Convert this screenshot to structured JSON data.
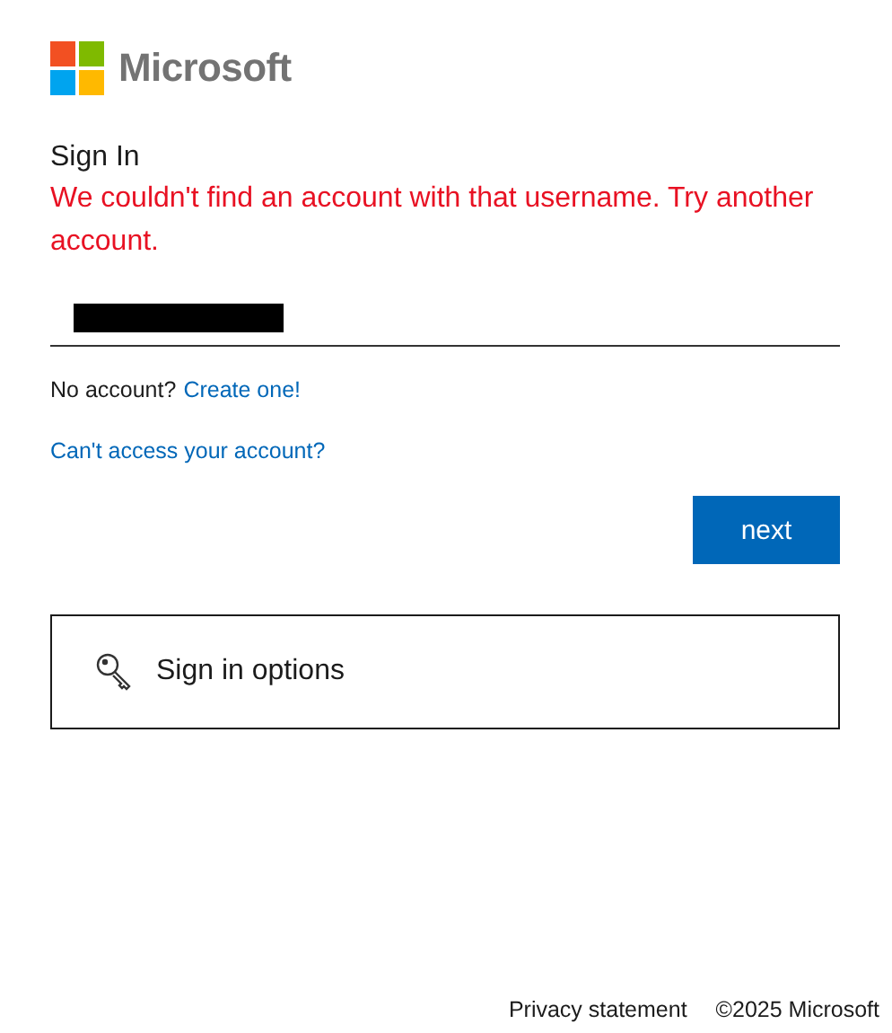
{
  "brand": {
    "name": "Microsoft"
  },
  "heading": "Sign In",
  "error": "We couldn't find an account with that username. Try another account.",
  "username_field": {
    "value_redacted": true
  },
  "no_account": {
    "text": "No account?",
    "link": "Create one!"
  },
  "cant_access_link": "Can't access your account?",
  "next_button": "next",
  "sign_in_options": "Sign in options",
  "footer": [
    "Privacy statement",
    "©2025 Microsoft"
  ]
}
